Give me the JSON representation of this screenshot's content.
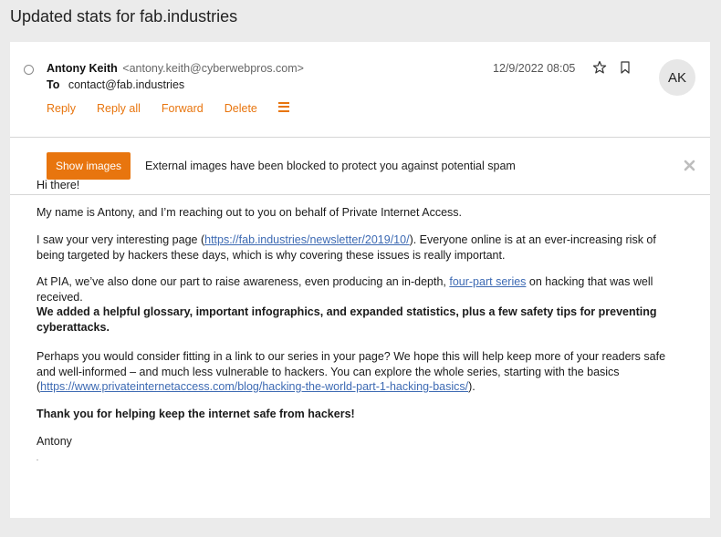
{
  "subject": "Updated stats for fab.industries",
  "message": {
    "from_name": "Antony Keith",
    "from_email": "<antony.keith@cyberwebpros.com>",
    "to_label": "To",
    "to_address": "contact@fab.industries",
    "date": "12/9/2022 08:05",
    "avatar_initials": "AK",
    "actions": {
      "reply": "Reply",
      "reply_all": "Reply all",
      "forward": "Forward",
      "delete": "Delete"
    }
  },
  "banner": {
    "button_label": "Show images",
    "message": "External images have been blocked to protect you against potential spam"
  },
  "body": {
    "greeting": "Hi there!",
    "p1": "My name is Antony, and I’m reaching out to you on behalf of Private Internet Access.",
    "p2_before": "I saw your very interesting page (",
    "p2_link": "https://fab.industries/newsletter/2019/10/",
    "p2_after": "). Everyone online is at an ever-increasing risk of being targeted by hackers these days, which is why covering these issues is really important.",
    "p3_before": "At PIA, we’ve also done our part to raise awareness, even producing an in-depth, ",
    "p3_link": "four-part series",
    "p3_after": " on hacking that was well received.",
    "p3_bold": "We added a helpful glossary, important infographics, and expanded statistics, plus a few safety tips for preventing cyberattacks.",
    "p4_before": "Perhaps you would consider fitting in a link to our series in your page? We hope this will help keep more of your readers safe and well-informed – and much less vulnerable to hackers. You can explore the whole series, starting with the basics (",
    "p4_link": "https://www.privateinternetaccess.com/blog/hacking-the-world-part-1-hacking-basics/",
    "p4_after": ").",
    "p5": "Thank you for helping keep the internet safe from hackers!",
    "signature": "Antony"
  },
  "icons": {
    "star": "star-outline-icon",
    "flag": "bookmark-outline-icon",
    "menu": "hamburger-menu-icon",
    "close": "close-icon",
    "select": "radio-circle-icon"
  },
  "colors": {
    "accent": "#e8750e",
    "link": "#3d6ab3",
    "background": "#ebebeb"
  }
}
